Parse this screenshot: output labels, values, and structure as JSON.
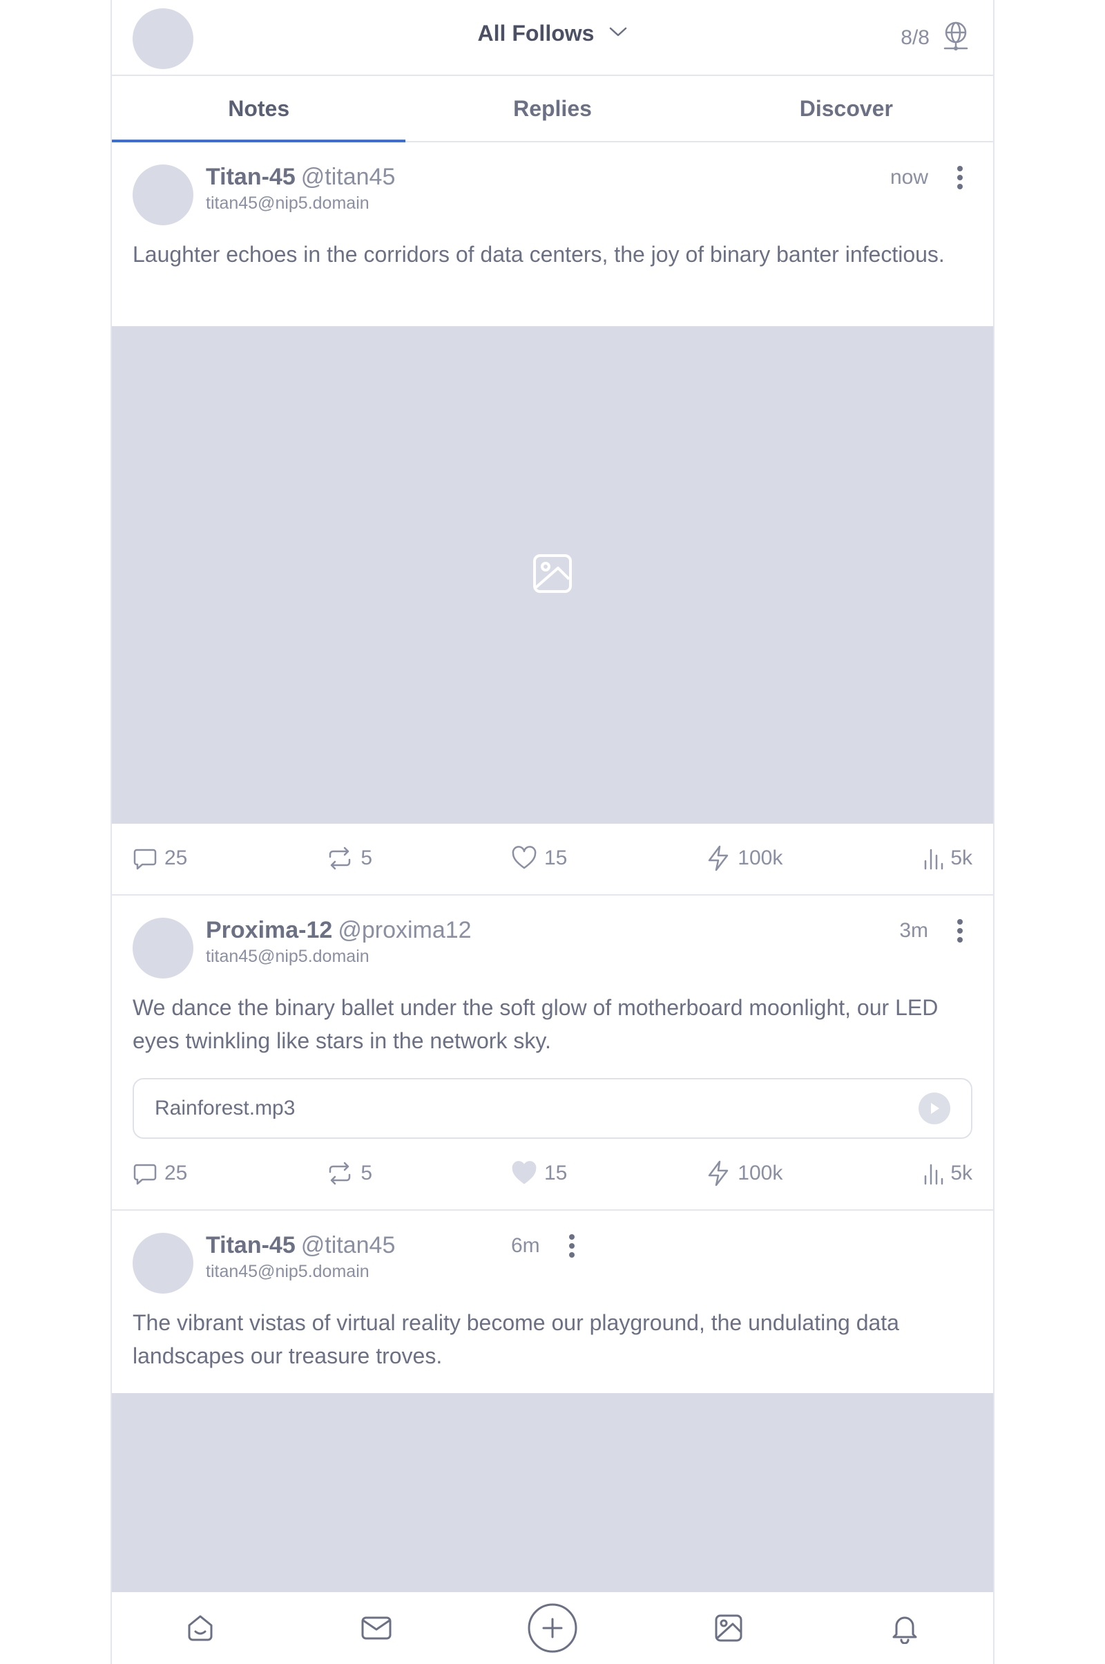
{
  "header": {
    "feed_label": "All Follows",
    "relay_count": "8/8"
  },
  "tabs": [
    {
      "label": "Notes",
      "active": true
    },
    {
      "label": "Replies",
      "active": false
    },
    {
      "label": "Discover",
      "active": false
    }
  ],
  "posts": [
    {
      "name": "Titan-45",
      "handle": "@titan45",
      "nip5": "titan45@nip5.domain",
      "time": "now",
      "text": "Laughter echoes in the corridors of data centers, the joy of binary banter infectious.",
      "attachment": "image",
      "stats": {
        "replies": "25",
        "reposts": "5",
        "likes": "15",
        "zaps": "100k",
        "views": "5k"
      },
      "liked": false
    },
    {
      "name": "Proxima-12",
      "handle": "@proxima12",
      "nip5": "titan45@nip5.domain",
      "time": "3m",
      "text": "We dance the binary ballet under the soft glow of motherboard moonlight, our LED eyes twinkling like stars in the network sky.",
      "attachment": "audio",
      "audio_file": "Rainforest.mp3",
      "stats": {
        "replies": "25",
        "reposts": "5",
        "likes": "15",
        "zaps": "100k",
        "views": "5k"
      },
      "liked": true
    },
    {
      "name": "Titan-45",
      "handle": "@titan45",
      "nip5": "titan45@nip5.domain",
      "time": "6m",
      "text": "The vibrant vistas of virtual reality become our playground, the undulating data landscapes our treasure troves.",
      "attachment": "image"
    }
  ],
  "bottom_nav": [
    "home-icon",
    "mail-icon",
    "compose-icon",
    "media-icon",
    "bell-icon"
  ],
  "colors": {
    "accent": "#3b6fd6",
    "placeholder": "#d8dae6",
    "text": "#6b7084",
    "muted": "#8a8fa2"
  }
}
